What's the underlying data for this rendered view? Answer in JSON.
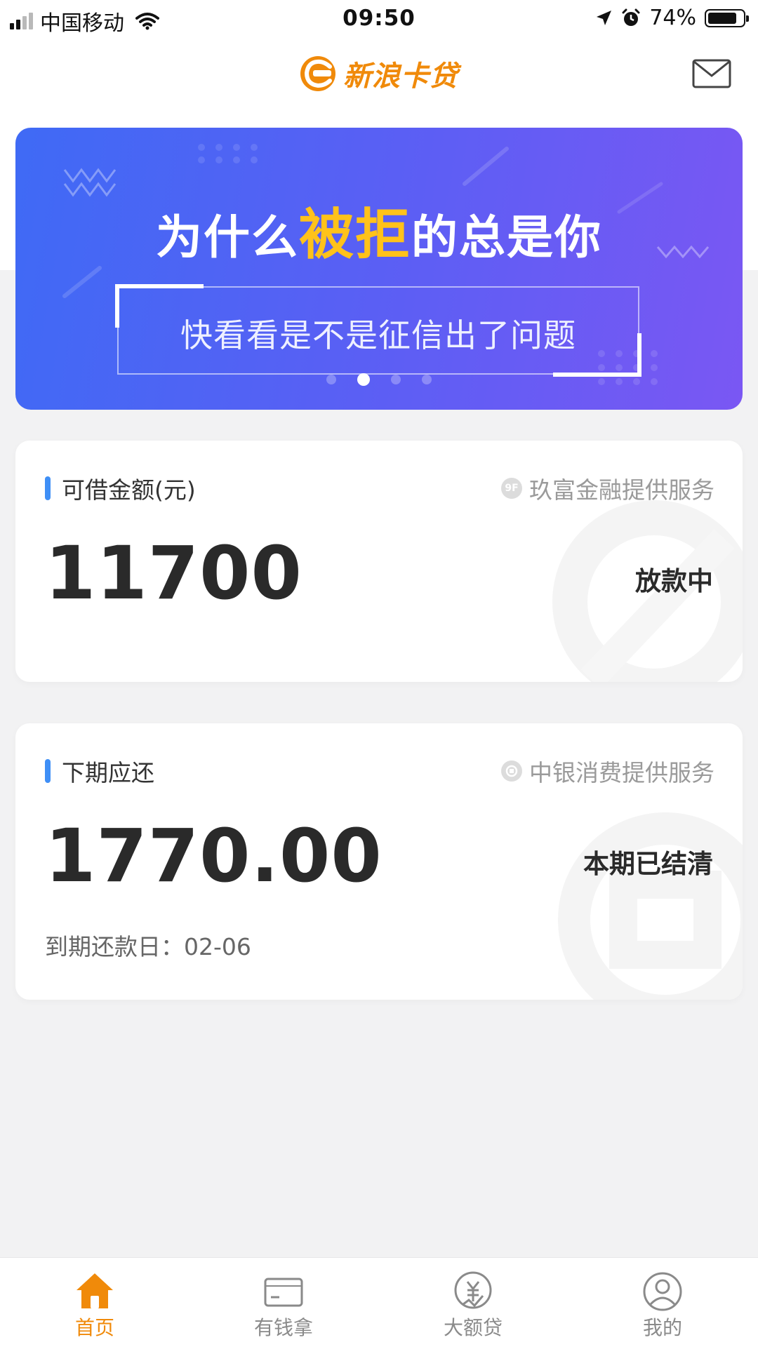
{
  "status_bar": {
    "carrier": "中国移动",
    "time": "09:50",
    "battery": "74%",
    "battery_level": 0.74
  },
  "header": {
    "brand": "新浪卡贷",
    "mail_icon": "mail-icon"
  },
  "banner": {
    "title_before": "为什么",
    "title_highlight": "被拒",
    "title_after": "的总是你",
    "subtitle": "快看看是不是征信出了问题",
    "page_count": 4,
    "active_page": 2,
    "highlight_color": "#ffc21a"
  },
  "loan_card": {
    "label": "可借金额(元)",
    "provider": "玖富金融提供服务",
    "provider_icon_text": "9F",
    "amount": "11700",
    "status": "放款中"
  },
  "repay_card": {
    "label": "下期应还",
    "provider": "中银消费提供服务",
    "amount": "1770.00",
    "status": "本期已结清",
    "due_label": "到期还款日：",
    "due_date": "02-06"
  },
  "tabbar": {
    "items": [
      {
        "label": "首页",
        "icon": "home-icon",
        "active": true
      },
      {
        "label": "有钱拿",
        "icon": "card-icon",
        "active": false
      },
      {
        "label": "大额贷",
        "icon": "yuan-badge-icon",
        "active": false
      },
      {
        "label": "我的",
        "icon": "user-icon",
        "active": false
      }
    ]
  },
  "colors": {
    "brand_orange": "#f08a0a",
    "accent_blue": "#3f8ff6",
    "banner_start": "#3f6af5",
    "banner_end": "#7a57f3"
  }
}
